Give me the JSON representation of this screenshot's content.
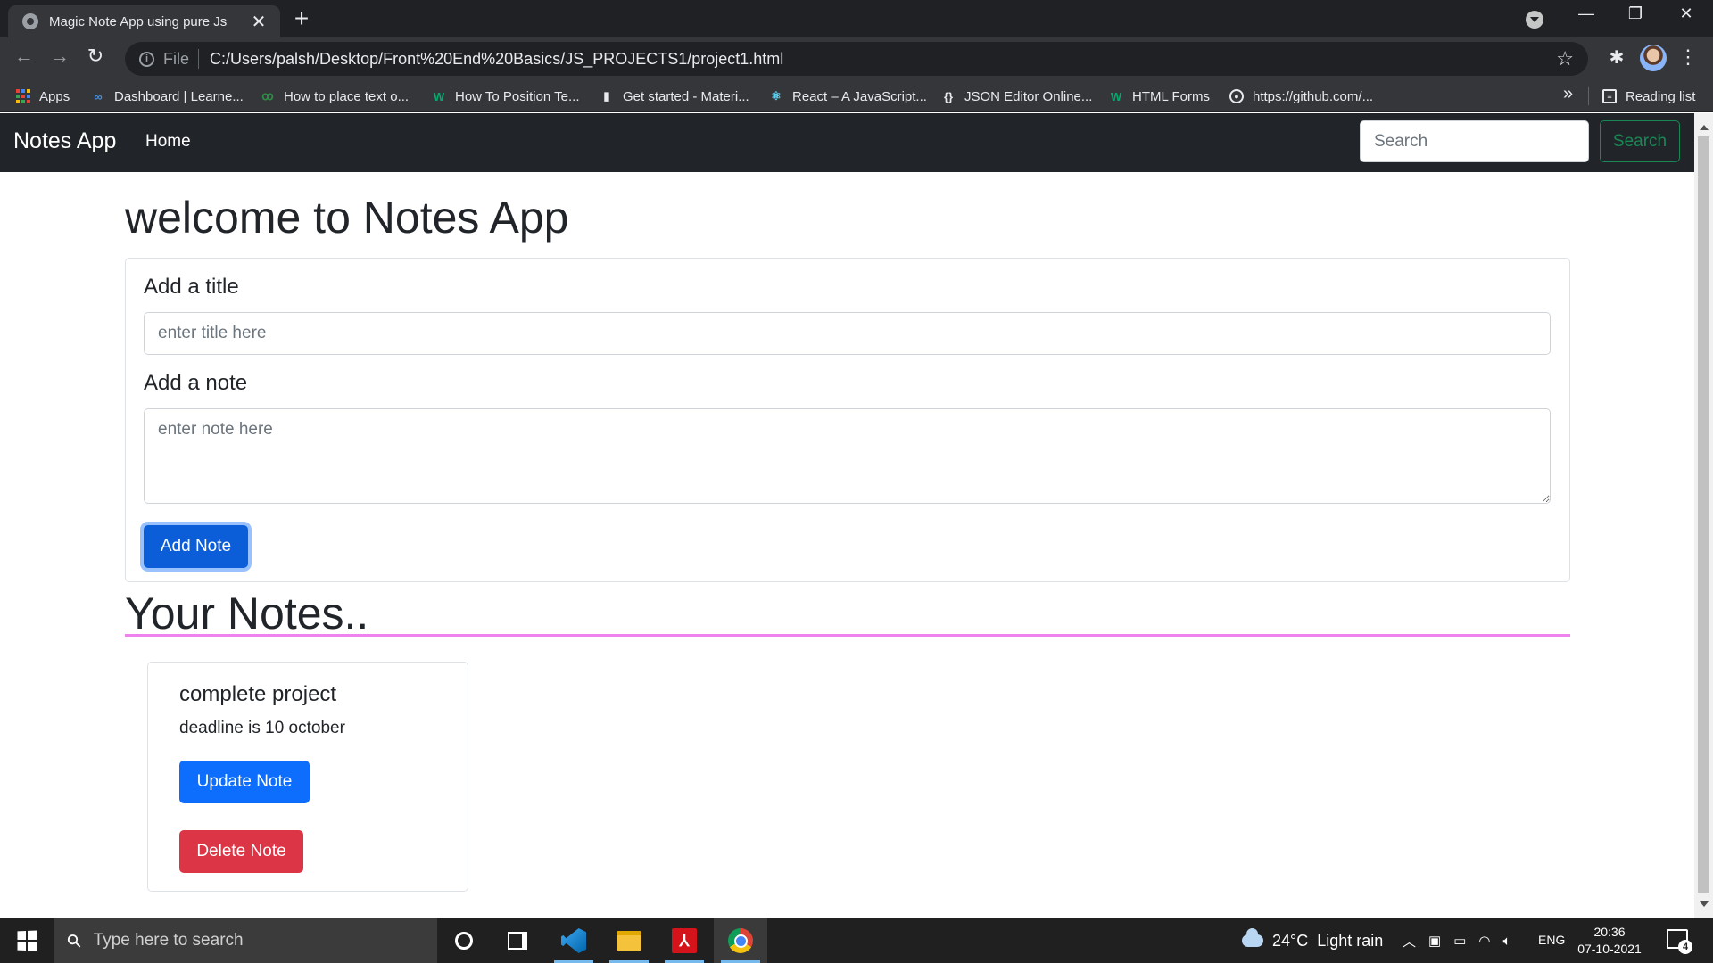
{
  "browser": {
    "tab_title": "Magic Note App using pure Js",
    "tab_close": "✕",
    "new_tab": "+",
    "scheme": "File",
    "url": "C:/Users/palsh/Desktop/Front%20End%20Basics/JS_PROJECTS1/project1.html",
    "window_controls": {
      "minimize": "—",
      "restore": "❐",
      "close": "✕"
    },
    "nav": {
      "back": "←",
      "forward": "→",
      "reload": "↻"
    },
    "star": "☆",
    "extensions": "✱",
    "menu": "⋮",
    "bookmarks": [
      {
        "label": "Apps",
        "icon": "apps-grid-icon"
      },
      {
        "label": "Dashboard | Learne...",
        "icon": "infinity-icon",
        "color": "#4a90e2"
      },
      {
        "label": "How to place text o...",
        "icon": "gfg-icon",
        "color": "#2f8d46"
      },
      {
        "label": "How To Position Te...",
        "icon": "w3-icon",
        "color": "#04aa6d"
      },
      {
        "label": "Get started - Materi...",
        "icon": "material-icon",
        "color": "#e8eaed"
      },
      {
        "label": "React – A JavaScript...",
        "icon": "react-icon",
        "color": "#61dafb"
      },
      {
        "label": "JSON Editor Online...",
        "icon": "braces-icon",
        "color": "#e8eaed"
      },
      {
        "label": "HTML Forms",
        "icon": "w3-icon",
        "color": "#04aa6d"
      },
      {
        "label": "https://github.com/...",
        "icon": "github-icon",
        "color": "#e8eaed"
      }
    ],
    "bookmarks_more": "»",
    "reading_list": "Reading list"
  },
  "app": {
    "brand": "Notes App",
    "nav_home": "Home",
    "search_placeholder": "Search",
    "search_button": "Search",
    "heading": "welcome to Notes App",
    "title_label": "Add a title",
    "title_placeholder": "enter title here",
    "note_label": "Add a note",
    "note_placeholder": "enter note here",
    "add_button": "Add Note",
    "notes_heading": "Your Notes..",
    "notes": [
      {
        "title": "complete project",
        "text": "deadline is 10 october",
        "update_label": "Update Note",
        "delete_label": "Delete Note"
      }
    ]
  },
  "taskbar": {
    "search_placeholder": "Type here to search",
    "apps": [
      "cortana",
      "task-view",
      "vs-code",
      "file-explorer",
      "adobe-acrobat",
      "google-chrome"
    ],
    "weather_temp": "24°C",
    "weather_desc": "Light rain",
    "language": "ENG",
    "time": "20:36",
    "date": "07-10-2021",
    "notification_count": "4"
  },
  "colors": {
    "navbar": "#212529",
    "primary": "#0d6efd",
    "danger": "#dc3545",
    "success": "#198754",
    "divider": "#ee82ee"
  }
}
